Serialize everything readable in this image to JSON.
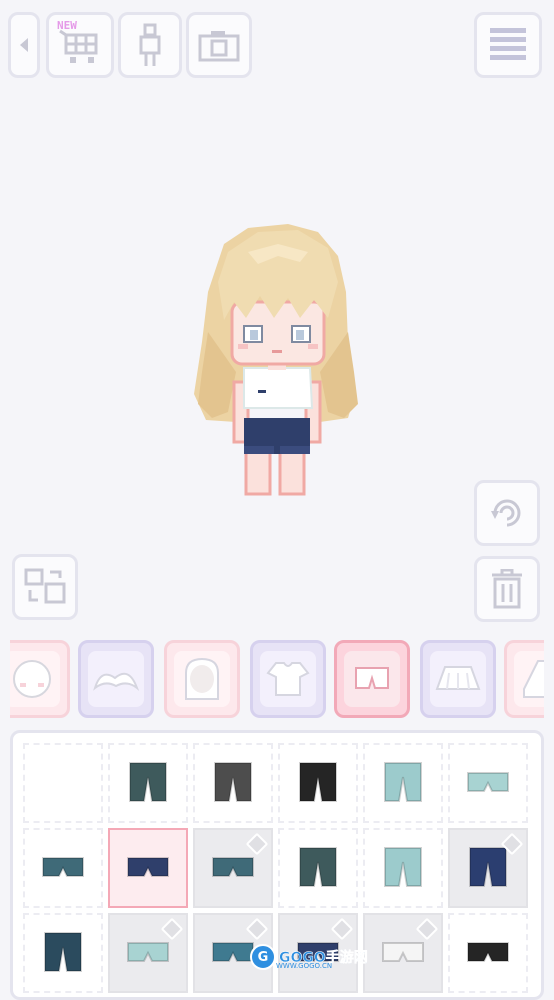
{
  "toolbar": {
    "shop_badge": "NEW"
  },
  "icons": {
    "back": "chevron-left-icon",
    "shop": "cart-icon",
    "body": "body-icon",
    "camera": "camera-icon",
    "menu": "hamburger-menu-icon",
    "rotate": "rotate-icon",
    "trash": "trash-icon",
    "swap": "swap-outfit-icon"
  },
  "categories": [
    {
      "name": "face",
      "style": "pink"
    },
    {
      "name": "eyebrows",
      "style": "lav"
    },
    {
      "name": "hair",
      "style": "pink"
    },
    {
      "name": "top",
      "style": "lav"
    },
    {
      "name": "shorts",
      "style": "active"
    },
    {
      "name": "skirt",
      "style": "lav"
    },
    {
      "name": "shoes",
      "style": "pink"
    }
  ],
  "items": [
    {
      "kind": "empty",
      "locked": false,
      "selected": false
    },
    {
      "kind": "pants",
      "color": "#3e5a5c",
      "locked": false,
      "selected": false
    },
    {
      "kind": "pants",
      "color": "#4d4d4d",
      "locked": false,
      "selected": false
    },
    {
      "kind": "pants",
      "color": "#252525",
      "locked": false,
      "selected": false
    },
    {
      "kind": "pants",
      "color": "#9ccbcc",
      "locked": false,
      "selected": false
    },
    {
      "kind": "shorts",
      "color": "#a8d3d2",
      "locked": false,
      "selected": false
    },
    {
      "kind": "shorts",
      "color": "#3f6a78",
      "locked": false,
      "selected": false
    },
    {
      "kind": "shorts",
      "color": "#2f3f6b",
      "locked": false,
      "selected": true
    },
    {
      "kind": "shorts",
      "color": "#3f6a78",
      "locked": true,
      "selected": false
    },
    {
      "kind": "pants",
      "color": "#3e5a5c",
      "locked": false,
      "selected": false
    },
    {
      "kind": "pants",
      "color": "#9ccbcc",
      "locked": false,
      "selected": false
    },
    {
      "kind": "pants",
      "color": "#2b3e70",
      "locked": true,
      "selected": false
    },
    {
      "kind": "pants",
      "color": "#2b4b5e",
      "locked": false,
      "selected": false
    },
    {
      "kind": "shorts",
      "color": "#a8d3d2",
      "locked": true,
      "selected": false
    },
    {
      "kind": "shorts",
      "color": "#3f7a90",
      "locked": true,
      "selected": false
    },
    {
      "kind": "shorts",
      "color": "#2f3f6b",
      "locked": true,
      "selected": false
    },
    {
      "kind": "shorts",
      "color": "#f5f5f5",
      "locked": true,
      "selected": false
    },
    {
      "kind": "shorts",
      "color": "#252525",
      "locked": false,
      "selected": false
    }
  ],
  "watermark": {
    "logo": "G",
    "brand": "GOGO手游网",
    "url": "WWW.GOGO.CN"
  },
  "colors": {
    "background": "#f5f5f9",
    "active_tab": "#fcd4dd",
    "icon_gray": "#c8c8d4"
  }
}
